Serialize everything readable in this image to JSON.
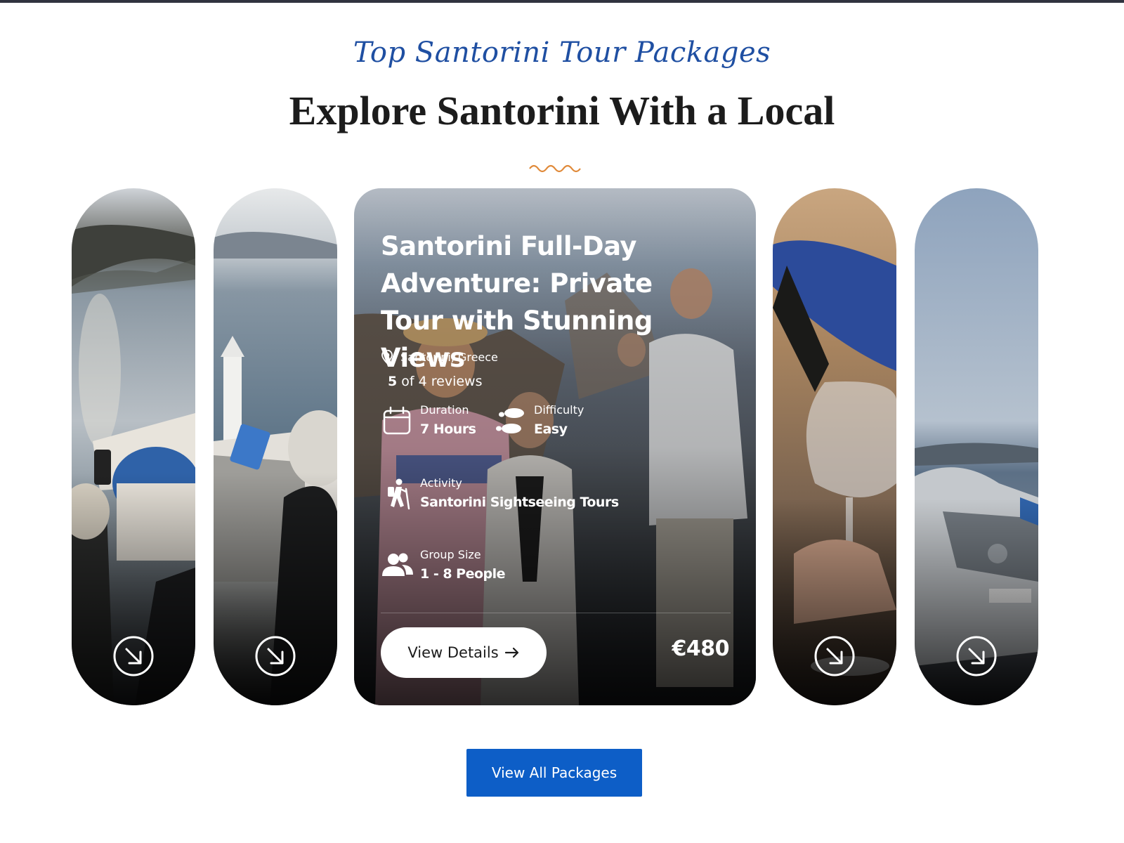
{
  "header": {
    "script_title": "Top Santorini Tour Packages",
    "main_title": "Explore Santorini With a Local"
  },
  "colors": {
    "accent_blue": "#0d5ec7",
    "script_blue": "#1f4fa2",
    "squiggle": "#e08a3a",
    "top_bar": "#30333f"
  },
  "carousel": {
    "featured": {
      "title": "Santorini Full-Day Adventure: Private Tour with Stunning Views",
      "location": "Santorini, Greece",
      "rating": "5",
      "reviews_text": "of 4 reviews",
      "features": {
        "duration": {
          "label": "Duration",
          "value": "7 Hours",
          "icon": "calendar-icon"
        },
        "difficulty": {
          "label": "Difficulty",
          "value": "Easy",
          "icon": "footprints-icon"
        },
        "activity": {
          "label": "Activity",
          "value": "Santorini Sightseeing Tours",
          "icon": "hiker-icon"
        },
        "group_size": {
          "label": "Group Size",
          "value": "1 - 8 People",
          "icon": "people-icon"
        }
      },
      "button_label": "View Details",
      "price": "€480"
    },
    "side_cards_icon": "arrow-down-right-circle-icon"
  },
  "footer": {
    "view_all_label": "View All Packages"
  }
}
